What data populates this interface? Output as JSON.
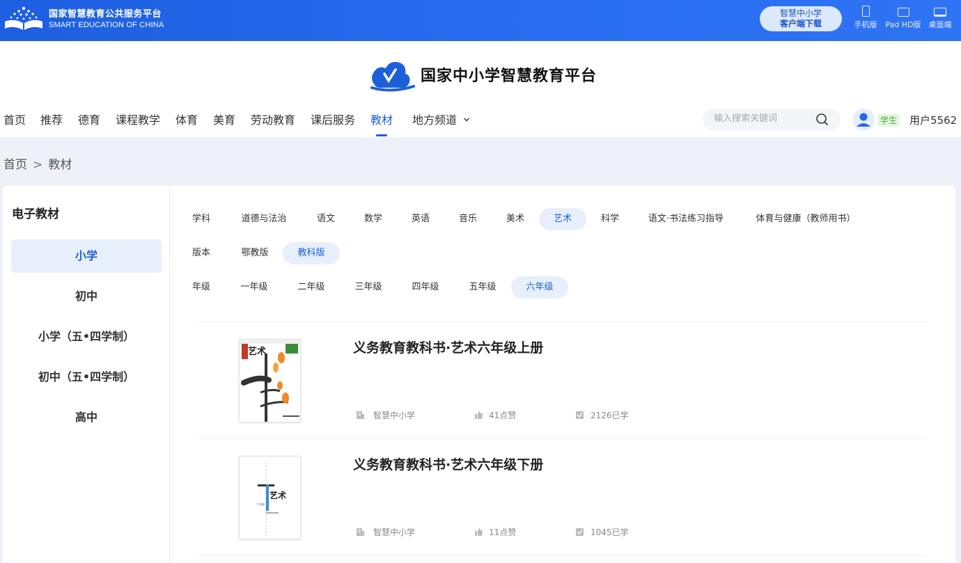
{
  "topbar": {
    "logo_cn": "国家智慧教育公共服务平台",
    "logo_en": "SMART EDUCATION OF CHINA",
    "client_btn_line1": "智慧中小学",
    "client_btn_line2": "客户端下载",
    "devices": [
      {
        "label": "手机版",
        "icon": "phone-icon"
      },
      {
        "label": "Pad HD版",
        "icon": "tablet-icon"
      },
      {
        "label": "桌面端",
        "icon": "desktop-icon"
      }
    ]
  },
  "header": {
    "brand_title": "国家中小学智慧教育平台",
    "nav": [
      {
        "label": "首页"
      },
      {
        "label": "推荐"
      },
      {
        "label": "德育"
      },
      {
        "label": "课程教学"
      },
      {
        "label": "体育"
      },
      {
        "label": "美育"
      },
      {
        "label": "劳动教育"
      },
      {
        "label": "课后服务"
      },
      {
        "label": "教材",
        "active": true
      },
      {
        "label": "地方频道",
        "dropdown": true
      }
    ],
    "search_placeholder": "输入搜索关键词",
    "role_badge": "学生",
    "username": "用户5562"
  },
  "breadcrumb": {
    "home": "首页",
    "sep": ">",
    "current": "教材"
  },
  "sidebar": {
    "title": "电子教材",
    "items": [
      {
        "label": "小学",
        "active": true
      },
      {
        "label": "初中"
      },
      {
        "label": "小学（五•四学制）"
      },
      {
        "label": "初中（五•四学制）"
      },
      {
        "label": "高中"
      }
    ]
  },
  "filters": {
    "subject": {
      "label": "学科",
      "options": [
        "道德与法治",
        "语文",
        "数学",
        "英语",
        "音乐",
        "美术",
        "艺术",
        "科学",
        "语文·书法练习指导",
        "体育与健康（教师用书）"
      ],
      "selected": "艺术"
    },
    "edition": {
      "label": "版本",
      "options": [
        "鄂教版",
        "教科版"
      ],
      "selected": "教科版"
    },
    "grade": {
      "label": "年级",
      "options": [
        "一年级",
        "二年级",
        "三年级",
        "四年级",
        "五年级",
        "六年级"
      ],
      "selected": "六年级"
    }
  },
  "books": [
    {
      "title": "义务教育教科书·艺术六年级上册",
      "publisher": "智慧中小学",
      "likes": "41点赞",
      "learners": "2126已学"
    },
    {
      "title": "义务教育教科书·艺术六年级下册",
      "publisher": "智慧中小学",
      "likes": "11点赞",
      "learners": "1045已学"
    }
  ],
  "colors": {
    "brand_blue": "#1a5fd8",
    "topbar_blue": "#2a6df0",
    "active_bg": "#e8effc"
  }
}
